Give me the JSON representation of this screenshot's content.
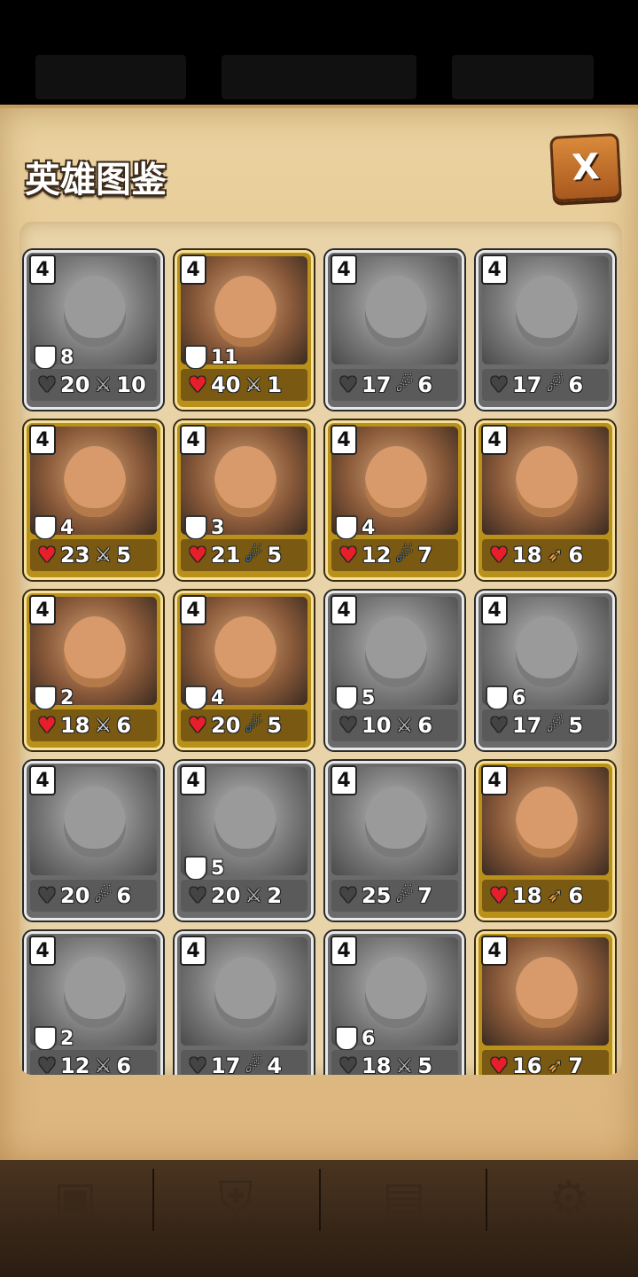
{
  "title": "英雄图鉴",
  "close_label": "X",
  "heroes": [
    {
      "level": "4",
      "armor": "8",
      "hp": "20",
      "atk": "10",
      "atk_type": "sword",
      "owned": false
    },
    {
      "level": "4",
      "armor": "11",
      "hp": "40",
      "atk": "1",
      "atk_type": "sword",
      "owned": true
    },
    {
      "level": "4",
      "armor": "",
      "hp": "17",
      "atk": "6",
      "atk_type": "magic",
      "owned": false
    },
    {
      "level": "4",
      "armor": "",
      "hp": "17",
      "atk": "6",
      "atk_type": "magic",
      "owned": false
    },
    {
      "level": "4",
      "armor": "4",
      "hp": "23",
      "atk": "5",
      "atk_type": "sword",
      "owned": true
    },
    {
      "level": "4",
      "armor": "3",
      "hp": "21",
      "atk": "5",
      "atk_type": "magic",
      "owned": true
    },
    {
      "level": "4",
      "armor": "4",
      "hp": "12",
      "atk": "7",
      "atk_type": "magic",
      "owned": true
    },
    {
      "level": "4",
      "armor": "",
      "hp": "18",
      "atk": "6",
      "atk_type": "bow",
      "owned": true
    },
    {
      "level": "4",
      "armor": "2",
      "hp": "18",
      "atk": "6",
      "atk_type": "sword",
      "owned": true
    },
    {
      "level": "4",
      "armor": "4",
      "hp": "20",
      "atk": "5",
      "atk_type": "magic",
      "owned": true
    },
    {
      "level": "4",
      "armor": "5",
      "hp": "10",
      "atk": "6",
      "atk_type": "sword",
      "owned": false
    },
    {
      "level": "4",
      "armor": "6",
      "hp": "17",
      "atk": "5",
      "atk_type": "magic",
      "owned": false
    },
    {
      "level": "4",
      "armor": "",
      "hp": "20",
      "atk": "6",
      "atk_type": "magic",
      "owned": false
    },
    {
      "level": "4",
      "armor": "5",
      "hp": "20",
      "atk": "2",
      "atk_type": "sword",
      "owned": false
    },
    {
      "level": "4",
      "armor": "",
      "hp": "25",
      "atk": "7",
      "atk_type": "magic",
      "owned": false
    },
    {
      "level": "4",
      "armor": "",
      "hp": "18",
      "atk": "6",
      "atk_type": "bow",
      "owned": true
    },
    {
      "level": "4",
      "armor": "2",
      "hp": "12",
      "atk": "6",
      "atk_type": "sword",
      "owned": false
    },
    {
      "level": "4",
      "armor": "",
      "hp": "17",
      "atk": "4",
      "atk_type": "magic",
      "owned": false
    },
    {
      "level": "4",
      "armor": "6",
      "hp": "18",
      "atk": "5",
      "atk_type": "sword",
      "owned": false
    },
    {
      "level": "4",
      "armor": "",
      "hp": "16",
      "atk": "7",
      "atk_type": "bow",
      "owned": true
    }
  ],
  "icons": {
    "hp": "heart-icon",
    "sword": "sword-icon",
    "magic": "magic-icon",
    "bow": "bow-icon",
    "armor": "shield-icon"
  },
  "bottom_nav": [
    {
      "icon": "chest-icon"
    },
    {
      "icon": "hero-emblem-icon"
    },
    {
      "icon": "shop-chest-icon"
    },
    {
      "icon": "gear-icon"
    }
  ]
}
